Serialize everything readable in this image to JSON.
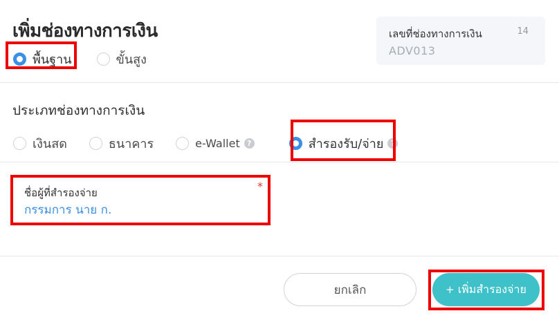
{
  "header": {
    "title": "เพิ่มช่องทางการเงิน"
  },
  "mode": {
    "options": [
      {
        "label": "พื้นฐาน",
        "checked": true
      },
      {
        "label": "ขั้นสูง",
        "checked": false
      }
    ]
  },
  "number_card": {
    "label": "เลขที่ช่องทางการเงิน",
    "count": "14",
    "value": "ADV013"
  },
  "channel_type": {
    "title": "ประเภทช่องทางการเงิน",
    "options": [
      {
        "label": "เงินสด",
        "checked": false
      },
      {
        "label": "ธนาคาร",
        "checked": false
      },
      {
        "label": "e-Wallet",
        "checked": false,
        "help": "?"
      },
      {
        "label": "สำรองรับ/จ่าย",
        "checked": true,
        "help": "?"
      }
    ]
  },
  "advance_payer": {
    "label": "ชื่อผู้ที่สำรองจ่าย",
    "required_mark": "*",
    "value": "กรรมการ นาย ก."
  },
  "footer": {
    "cancel_label": "ยกเลิก",
    "add_icon": "+",
    "add_label": "เพิ่มสำรองจ่าย"
  },
  "colors": {
    "accent": "#3b8fe6",
    "primary_button": "#3ec1c9",
    "highlight": "#ee0000",
    "required": "#e53935"
  }
}
